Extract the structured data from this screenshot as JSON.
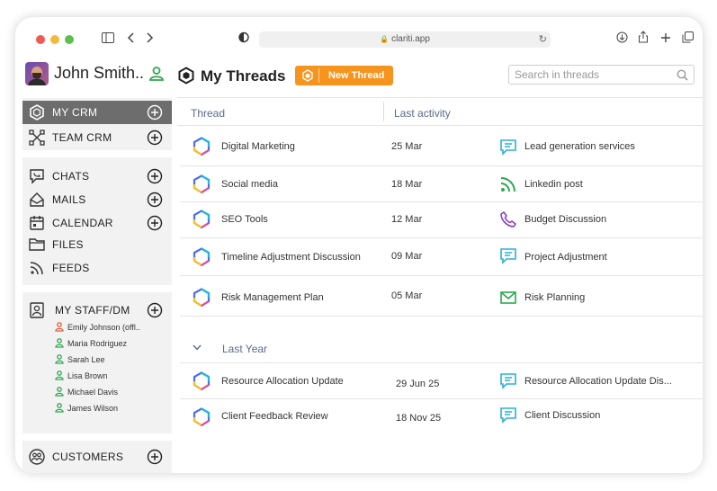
{
  "browser": {
    "url": "clariti.app",
    "controls": [
      "sidebar-toggle-icon",
      "back-icon",
      "forward-icon",
      "shield-icon",
      "download-icon",
      "share-icon",
      "new-tab-icon",
      "tabs-icon"
    ]
  },
  "user": {
    "name": "John Smith..",
    "status_color": "#2fa84f"
  },
  "sidebar": {
    "crm": [
      {
        "label": "MY CRM",
        "active": true,
        "icon": "hexagon-icon"
      },
      {
        "label": "TEAM CRM",
        "active": false,
        "icon": "network-icon"
      }
    ],
    "comms": [
      {
        "label": "CHATS",
        "icon": "chat-icon",
        "plus": true
      },
      {
        "label": "MAILS",
        "icon": "mail-icon",
        "plus": true
      },
      {
        "label": "CALENDAR",
        "icon": "calendar-icon",
        "plus": true
      },
      {
        "label": "FILES",
        "icon": "folder-icon",
        "plus": false
      },
      {
        "label": "FEEDS",
        "icon": "rss-icon",
        "plus": false
      }
    ],
    "staff_title": "MY STAFF/DM",
    "staff": [
      {
        "name": "Emily Johnson  (offl..",
        "color": "#e0603a"
      },
      {
        "name": "Maria Rodriguez",
        "color": "#2fa84f"
      },
      {
        "name": "Sarah Lee",
        "color": "#2fa84f"
      },
      {
        "name": "Lisa Brown",
        "color": "#2fa84f"
      },
      {
        "name": "Michael Davis",
        "color": "#2fa84f"
      },
      {
        "name": "James Wilson",
        "color": "#2fa84f"
      }
    ],
    "customers": "CUSTOMERS"
  },
  "main": {
    "title": "My Threads",
    "new_thread": "New Thread",
    "search_placeholder": "Search in threads",
    "col_thread": "Thread",
    "col_activity": "Last activity",
    "threads": [
      {
        "name": "Digital Marketing",
        "date": "25 Mar",
        "activity": "Lead generation services",
        "activity_icon": "chat-icon"
      },
      {
        "name": "Social media",
        "date": "18 Mar",
        "activity": "Linkedin post",
        "activity_icon": "rss-icon"
      },
      {
        "name": "SEO Tools",
        "date": "12 Mar",
        "activity": "Budget Discussion",
        "activity_icon": "phone-icon"
      },
      {
        "name": "Timeline Adjustment Discussion",
        "date": "09 Mar",
        "activity": "Project Adjustment",
        "activity_icon": "chat-icon"
      },
      {
        "name": "Risk Management Plan",
        "date": "05 Mar",
        "activity": "Risk Planning",
        "activity_icon": "mail-icon"
      }
    ],
    "section_label": "Last Year",
    "older_threads": [
      {
        "name": "Resource Allocation Update",
        "date": "29 Jun 25",
        "activity": "Resource Allocation Update Dis...",
        "activity_icon": "chat-icon"
      },
      {
        "name": "Client Feedback Review",
        "date": "18 Nov 25",
        "activity": "Client Discussion",
        "activity_icon": "chat-icon"
      }
    ]
  },
  "colors": {
    "accent": "#f7941d",
    "active_nav": "#6d6d6d",
    "chat": "#2ab0d8",
    "rss": "#2fa84f",
    "phone": "#8a3fc4",
    "mail": "#2fa84f"
  }
}
